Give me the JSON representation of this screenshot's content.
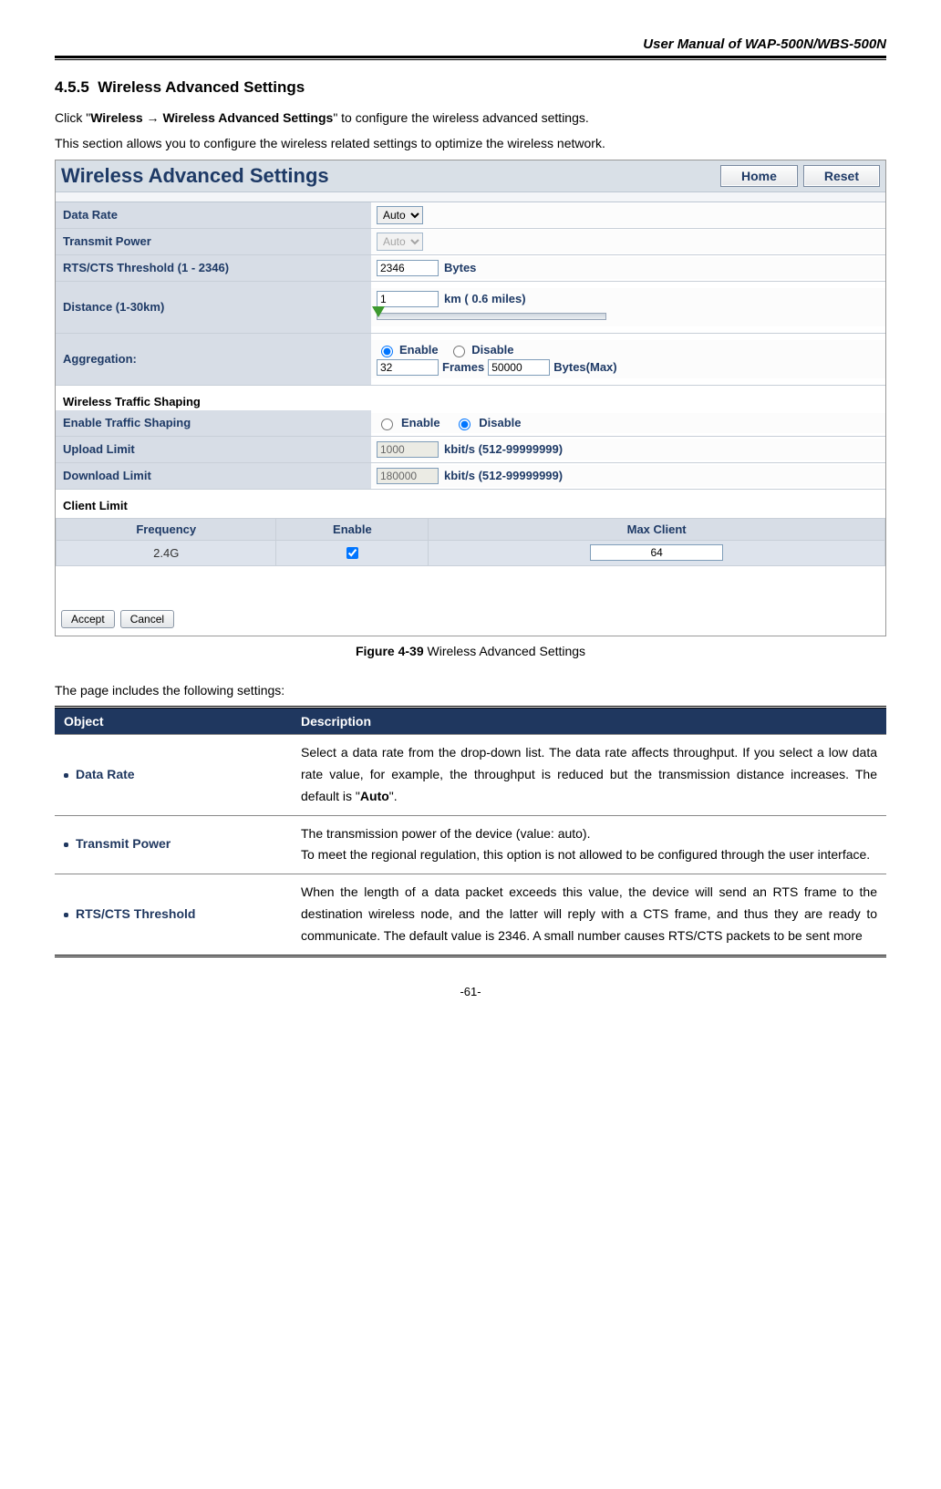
{
  "header": {
    "title": "User Manual of WAP-500N/WBS-500N"
  },
  "section": {
    "number": "4.5.5",
    "title": "Wireless Advanced Settings",
    "intro1_pre": "Click \"",
    "intro1_bold": "Wireless → Wireless Advanced Settings",
    "intro1_post": "\" to configure the wireless advanced settings.",
    "intro2": "This section allows you to configure the wireless related settings to optimize the wireless network."
  },
  "screenshot": {
    "title": "Wireless Advanced Settings",
    "buttons": {
      "home": "Home",
      "reset": "Reset"
    },
    "rows": {
      "data_rate": {
        "label": "Data Rate",
        "value": "Auto"
      },
      "tx_power": {
        "label": "Transmit Power",
        "value": "Auto"
      },
      "rts": {
        "label": "RTS/CTS Threshold (1 - 2346)",
        "value": "2346",
        "unit": "Bytes"
      },
      "distance": {
        "label": "Distance (1-30km)",
        "value": "1",
        "unit": "km  ( 0.6 miles)"
      },
      "aggregation": {
        "label": "Aggregation:",
        "enable": "Enable",
        "disable": "Disable",
        "frames_value": "32",
        "frames_label": "Frames",
        "bytes_value": "50000",
        "bytes_label": "Bytes(Max)"
      }
    },
    "shaping": {
      "heading": "Wireless Traffic Shaping",
      "enable_row": {
        "label": "Enable Traffic Shaping",
        "enable": "Enable",
        "disable": "Disable"
      },
      "upload": {
        "label": "Upload Limit",
        "value": "1000",
        "unit": "kbit/s (512-99999999)"
      },
      "download": {
        "label": "Download Limit",
        "value": "180000",
        "unit": "kbit/s (512-99999999)"
      }
    },
    "client": {
      "heading": "Client Limit",
      "cols": {
        "freq": "Frequency",
        "enable": "Enable",
        "max": "Max Client"
      },
      "row": {
        "freq": "2.4G",
        "max": "64"
      }
    },
    "footer": {
      "accept": "Accept",
      "cancel": "Cancel"
    }
  },
  "figure": {
    "label": "Figure 4-39",
    "caption": "Wireless Advanced Settings"
  },
  "desc": {
    "lead": "The page includes the following settings:",
    "headers": {
      "object": "Object",
      "description": "Description"
    },
    "rows": [
      {
        "object": "Data Rate",
        "description_pre": "Select a data rate from the drop-down list. The data rate affects throughput. If you select a low data rate value, for example, the throughput is reduced but the transmission distance increases. The default is \"",
        "description_bold": "Auto",
        "description_post": "\"."
      },
      {
        "object": "Transmit Power",
        "description": "The transmission power of the device (value: auto).\nTo meet the regional regulation, this option is not allowed to be configured through the user interface."
      },
      {
        "object": "RTS/CTS Threshold",
        "description": "When the length of a data packet exceeds this value, the device will send an RTS frame to the destination wireless node, and the latter will reply with a CTS frame, and thus they are ready to communicate. The default value is 2346. A small number causes RTS/CTS packets to be sent more"
      }
    ]
  },
  "page_number": "-61-"
}
